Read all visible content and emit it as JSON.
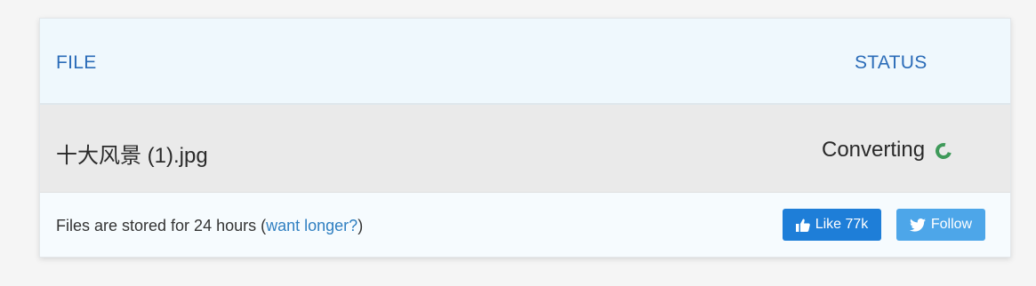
{
  "table": {
    "headers": {
      "file": "FILE",
      "status": "STATUS"
    },
    "rows": [
      {
        "filename": "十大风景 (1).jpg",
        "status": "Converting"
      }
    ]
  },
  "footer": {
    "note_prefix": "Files are stored for 24 hours (",
    "note_link": "want longer?",
    "note_suffix": ")",
    "like_label": "Like 77k",
    "follow_label": "Follow"
  },
  "icons": {
    "like": "thumbs-up-icon",
    "follow": "twitter-bird-icon",
    "status": "loading-spinner-icon"
  },
  "colors": {
    "header_text": "#2b6cb8",
    "spinner": "#3f9a5a",
    "like_button": "#1e7ed8",
    "follow_button": "#4da6e9",
    "link": "#2f7fc1"
  }
}
